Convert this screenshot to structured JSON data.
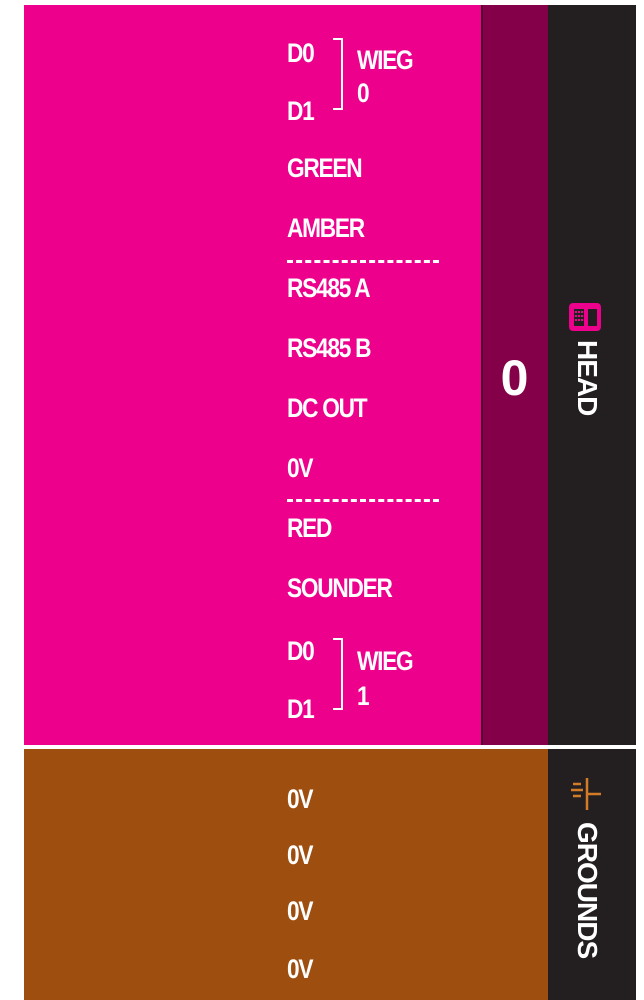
{
  "head": {
    "labels": [
      "D0",
      "D1",
      "GREEN",
      "AMBER",
      "RS485 A",
      "RS485 B",
      "DC OUT",
      "0V",
      "RED",
      "SOUNDER",
      "D0",
      "D1"
    ],
    "wiegand_top": [
      "WIEG",
      "0"
    ],
    "wiegand_bottom": [
      "WIEG",
      "1"
    ],
    "port_number": "0",
    "side_label": "HEAD",
    "colors": {
      "panel": "#ec008c",
      "bar": "#840048",
      "side": "#231f20"
    }
  },
  "grounds": {
    "labels": [
      "0V",
      "0V",
      "0V",
      "0V"
    ],
    "side_label": "GROUNDS",
    "colors": {
      "panel": "#9e4f0f",
      "side": "#231f20",
      "icon": "#d27c28"
    }
  },
  "icons": {
    "head": "reader-icon",
    "grounds": "ground-icon"
  }
}
